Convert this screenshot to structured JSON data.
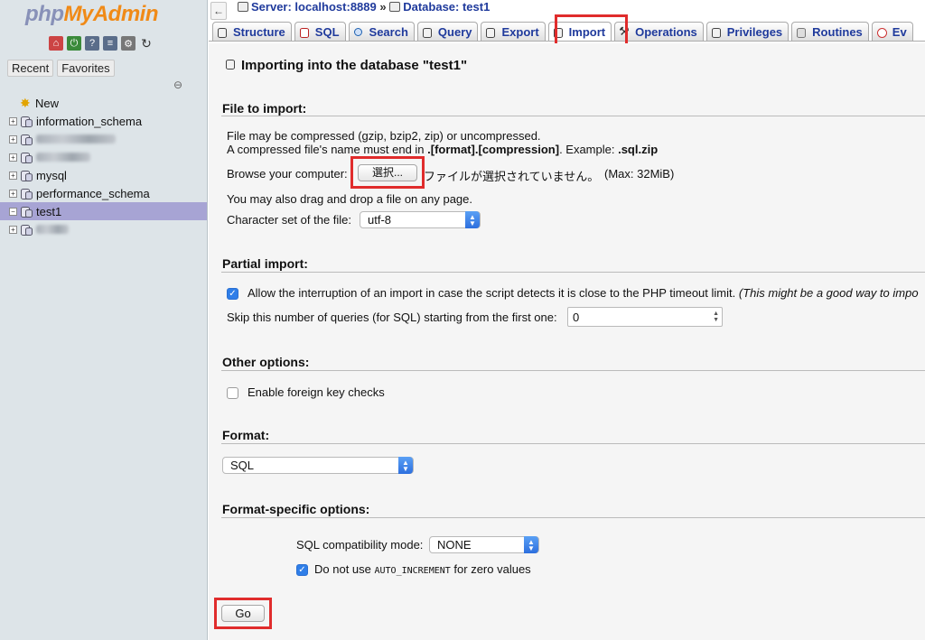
{
  "sidebar": {
    "logo": {
      "php": "php",
      "myadmin": "MyAdmin"
    },
    "tabs": {
      "recent": "Recent",
      "favorites": "Favorites"
    },
    "tree": [
      {
        "label": "New",
        "kind": "new"
      },
      {
        "label": "information_schema",
        "kind": "db"
      },
      {
        "label": "",
        "kind": "db",
        "obscured": true
      },
      {
        "label": "",
        "kind": "db",
        "obscured": true
      },
      {
        "label": "mysql",
        "kind": "db"
      },
      {
        "label": "performance_schema",
        "kind": "db"
      },
      {
        "label": "test1",
        "kind": "db",
        "selected": true
      },
      {
        "label": "",
        "kind": "db",
        "obscured": true
      }
    ]
  },
  "breadcrumb": {
    "server": "Server: localhost:8889",
    "separator": "»",
    "database": "Database: test1"
  },
  "tabs": [
    {
      "label": "Structure",
      "icon": "structure-icon"
    },
    {
      "label": "SQL",
      "icon": "sql-icon"
    },
    {
      "label": "Search",
      "icon": "search-icon"
    },
    {
      "label": "Query",
      "icon": "query-icon"
    },
    {
      "label": "Export",
      "icon": "export-icon"
    },
    {
      "label": "Import",
      "icon": "import-icon",
      "active": true
    },
    {
      "label": "Operations",
      "icon": "operations-icon"
    },
    {
      "label": "Privileges",
      "icon": "privileges-icon"
    },
    {
      "label": "Routines",
      "icon": "routines-icon"
    },
    {
      "label": "Ev",
      "icon": "events-icon"
    }
  ],
  "page": {
    "title": "Importing into the database \"test1\""
  },
  "file_import": {
    "heading": "File to import:",
    "line1": "File may be compressed (gzip, bzip2, zip) or uncompressed.",
    "line2_prefix": "A compressed file's name must end in ",
    "line2_format": ".[format].[compression]",
    "line2_middle": ". Example: ",
    "line2_example": ".sql.zip",
    "browse_label": "Browse your computer:",
    "choose_button": "選択...",
    "no_file": "ファイルが選択されていません。",
    "max_size": "(Max: 32MiB)",
    "drag_hint": "You may also drag and drop a file on any page.",
    "charset_label": "Character set of the file:",
    "charset_value": "utf-8"
  },
  "partial_import": {
    "heading": "Partial import:",
    "allow_interrupt_checked": true,
    "allow_interrupt_label": "Allow the interruption of an import in case the script detects it is close to the PHP timeout limit.",
    "allow_interrupt_note": "(This might be a good way to impo",
    "skip_label": "Skip this number of queries (for SQL) starting from the first one:",
    "skip_value": "0"
  },
  "other_options": {
    "heading": "Other options:",
    "foreign_keys_checked": false,
    "foreign_keys_label": "Enable foreign key checks"
  },
  "format": {
    "heading": "Format:",
    "value": "SQL"
  },
  "format_specific": {
    "heading": "Format-specific options:",
    "compat_label": "SQL compatibility mode:",
    "compat_value": "NONE",
    "auto_inc_checked": true,
    "auto_inc_prefix": "Do not use ",
    "auto_inc_code": "AUTO_INCREMENT",
    "auto_inc_suffix": " for zero values"
  },
  "go_button": "Go",
  "colors": {
    "accent_red": "#e02c2c",
    "link_blue": "#1f3a9c",
    "selected_row": "#a7a4d4",
    "sidebar_bg": "#dde4e8"
  }
}
